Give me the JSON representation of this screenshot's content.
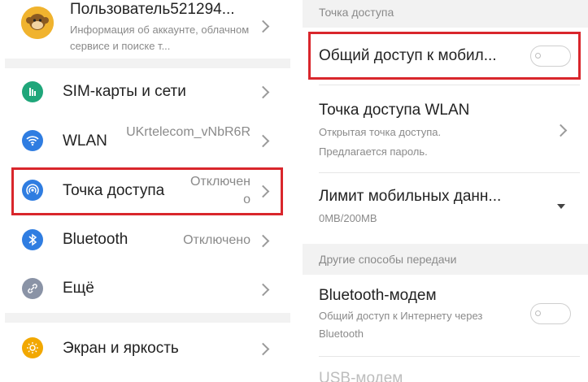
{
  "left_panel": {
    "account": {
      "name": "Пользователь521294...",
      "description": "Информация об аккаунте, облачном сервисе и поиске т..."
    },
    "items": [
      {
        "label": "SIM-карты и сети",
        "value": "",
        "icon": "sim-icon",
        "color": "#1fa67a"
      },
      {
        "label": "WLAN",
        "value": "UKrtelecom_vNbR6R",
        "icon": "wifi-icon",
        "color": "#2f7de1"
      },
      {
        "label": "Точка доступа",
        "value": "Отключено",
        "icon": "hotspot-icon",
        "color": "#2f7de1"
      },
      {
        "label": "Bluetooth",
        "value": "Отключено",
        "icon": "bluetooth-icon",
        "color": "#2f7de1"
      },
      {
        "label": "Ещё",
        "value": "",
        "icon": "link-icon",
        "color": "#8a93a6"
      },
      {
        "label": "Экран и яркость",
        "value": "",
        "icon": "sun-icon",
        "color": "#f2a800"
      }
    ]
  },
  "right_panel": {
    "section_hotspot": "Точка доступа",
    "mobile_share": {
      "label": "Общий доступ к мобил...",
      "enabled": false
    },
    "wlan_hotspot": {
      "label": "Точка доступа WLAN",
      "sub": "Открытая точка доступа. Предлагается пароль."
    },
    "data_limit": {
      "label": "Лимит мобильных данн...",
      "sub": "0MB/200MB"
    },
    "section_other": "Другие способы передачи",
    "bt_modem": {
      "label": "Bluetooth-модем",
      "sub": "Общий доступ к Интернету через Bluetooth",
      "enabled": false
    },
    "usb_modem": {
      "label": "USB-модем"
    }
  },
  "colors": {
    "highlight": "#d9262c",
    "background": "#f2f2f2"
  }
}
